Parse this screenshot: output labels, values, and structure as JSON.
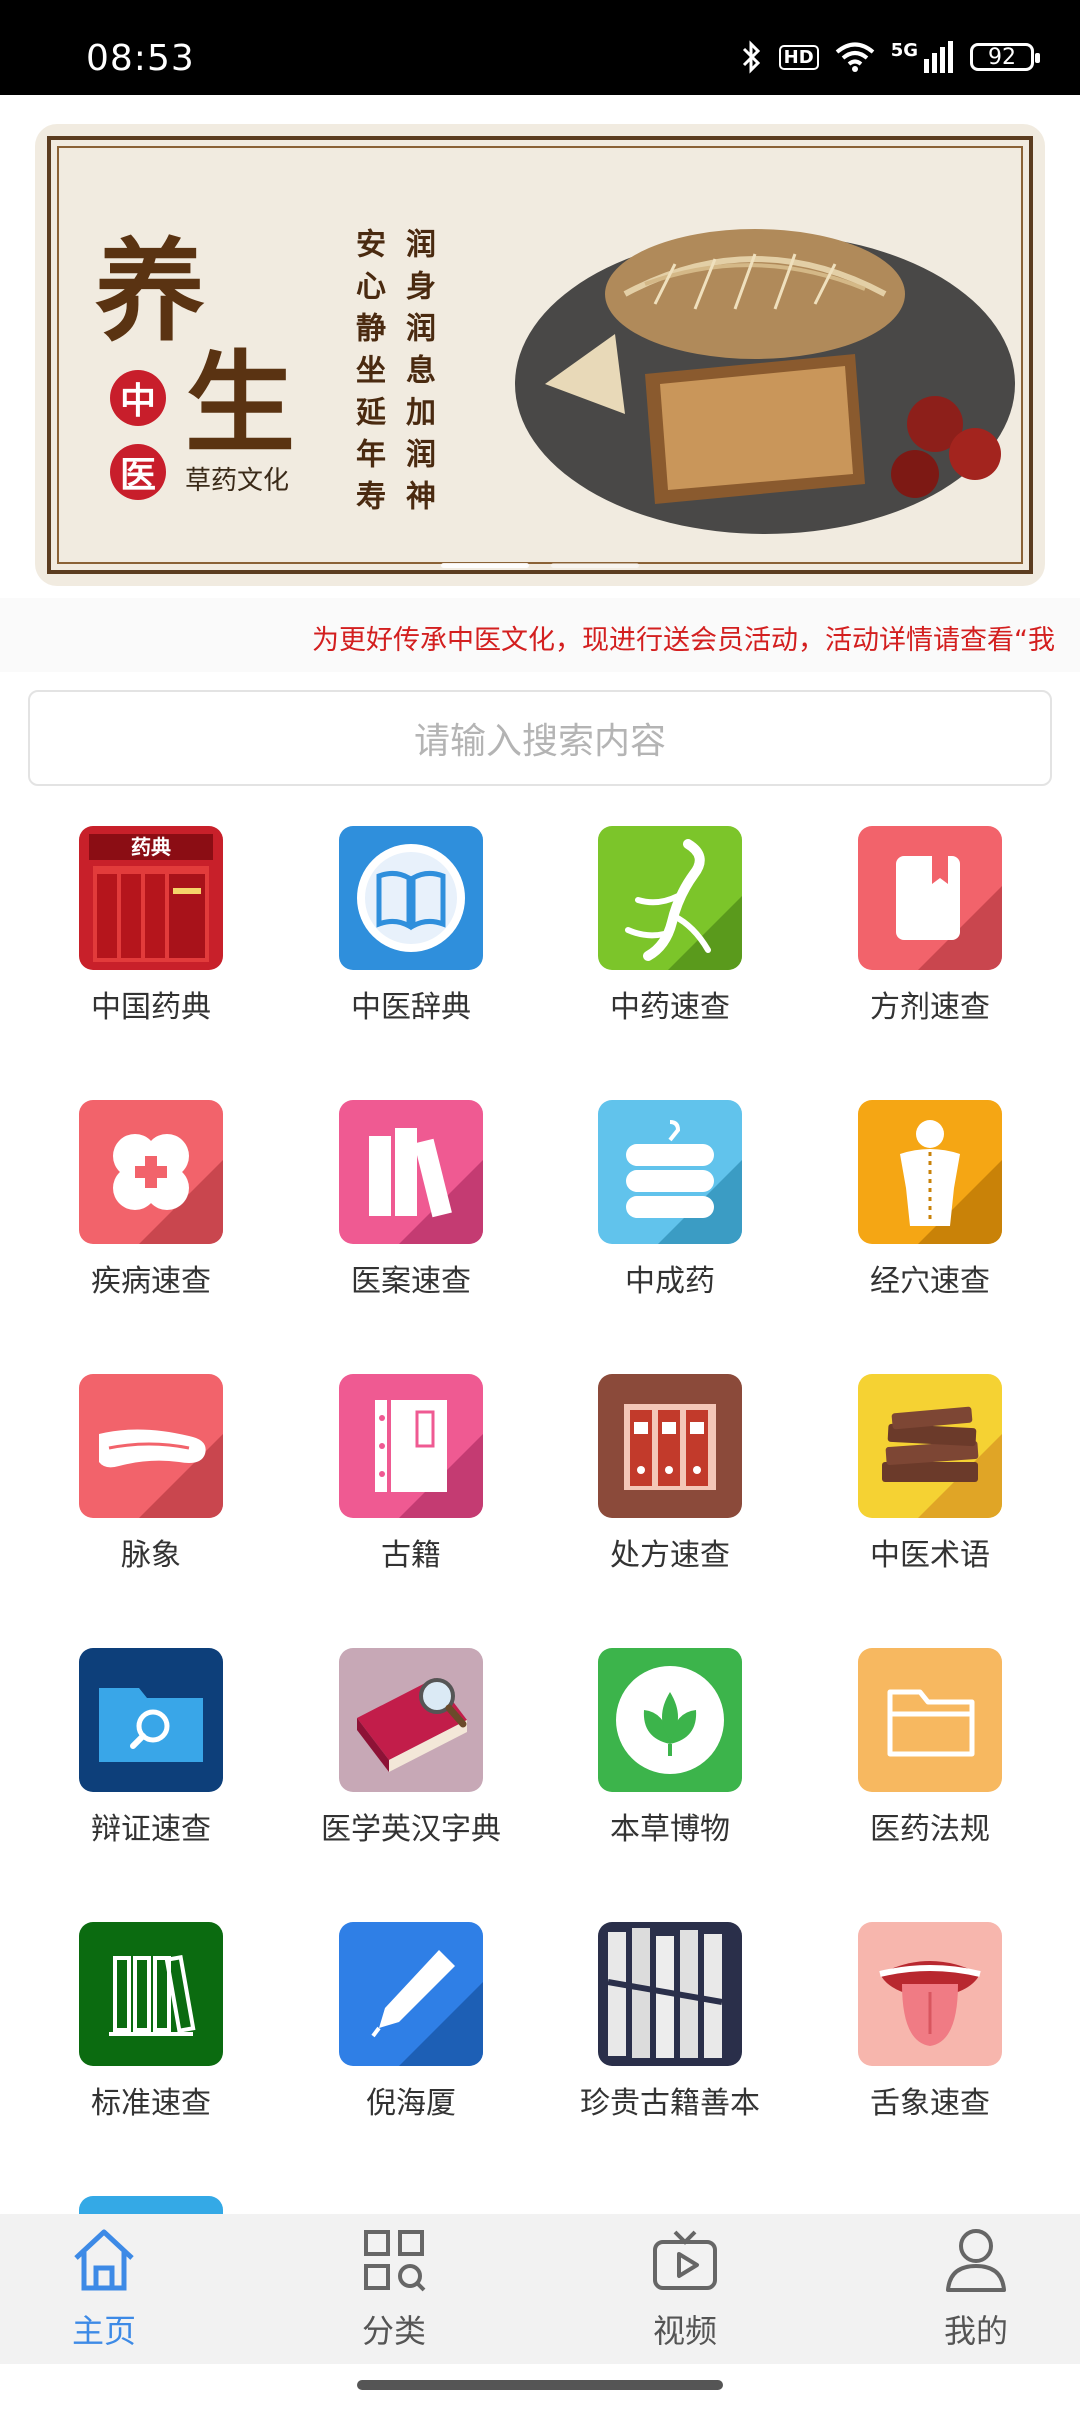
{
  "status": {
    "time": "08:53",
    "battery": "92",
    "network": "5G"
  },
  "banner": {
    "big_char_1": "养",
    "big_char_2": "生",
    "seal_1": "中",
    "seal_2": "医",
    "subtitle": "草药文化",
    "poem_1": "安心静坐延年寿",
    "poem_2": "润身润息加润神"
  },
  "ticker": {
    "text": "为更好传承中医文化，现进行送会员活动，活动详情请查看“我"
  },
  "search": {
    "placeholder": "请输入搜索内容"
  },
  "grid": [
    {
      "label": "中国药典",
      "icon": "pharmacopoeia-book-icon",
      "color": "#c8202a"
    },
    {
      "label": "中医辞典",
      "icon": "open-book-icon",
      "color": "#2f8fdc"
    },
    {
      "label": "中药速查",
      "icon": "ginseng-root-icon",
      "color": "#7cc52a"
    },
    {
      "label": "方剂速查",
      "icon": "bookmark-book-icon",
      "color": "#f2636b"
    },
    {
      "label": "疾病速查",
      "icon": "medical-cross-icon",
      "color": "#f2636b"
    },
    {
      "label": "医案速查",
      "icon": "books-icon",
      "color": "#ef5a92"
    },
    {
      "label": "中成药",
      "icon": "medicine-stack-icon",
      "color": "#61c3ec"
    },
    {
      "label": "经穴速查",
      "icon": "human-back-icon",
      "color": "#f5a614"
    },
    {
      "label": "脉象",
      "icon": "wrist-pulse-icon",
      "color": "#f2636b"
    },
    {
      "label": "古籍",
      "icon": "ancient-book-icon",
      "color": "#ef5a92"
    },
    {
      "label": "处方速查",
      "icon": "binders-icon",
      "color": "#8b4a3a"
    },
    {
      "label": "中医术语",
      "icon": "stacked-books-icon",
      "color": "#f5d233"
    },
    {
      "label": "辩证速查",
      "icon": "folder-search-icon",
      "color": "#0d3f7a"
    },
    {
      "label": "医学英汉字典",
      "icon": "dictionary-magnifier-icon",
      "color": "#c7a8b6"
    },
    {
      "label": "本草博物",
      "icon": "leaf-icon",
      "color": "#3cb44b"
    },
    {
      "label": "医药法规",
      "icon": "folder-icon",
      "color": "#f7b860"
    },
    {
      "label": "标准速查",
      "icon": "binders-green-icon",
      "color": "#0b6b10"
    },
    {
      "label": "倪海厦",
      "icon": "pen-icon",
      "color": "#2f7fe6"
    },
    {
      "label": "珍贵古籍善本",
      "icon": "rare-books-icon",
      "color": "#2a2f4a"
    },
    {
      "label": "舌象速查",
      "icon": "tongue-icon",
      "color": "#f7b6ad"
    }
  ],
  "nav": [
    {
      "label": "主页",
      "icon": "home-icon",
      "active": true
    },
    {
      "label": "分类",
      "icon": "category-grid-icon",
      "active": false
    },
    {
      "label": "视频",
      "icon": "video-tv-icon",
      "active": false
    },
    {
      "label": "我的",
      "icon": "profile-icon",
      "active": false
    }
  ],
  "colors": {
    "accent": "#3d8ae6",
    "ticker": "#d31f1f"
  }
}
